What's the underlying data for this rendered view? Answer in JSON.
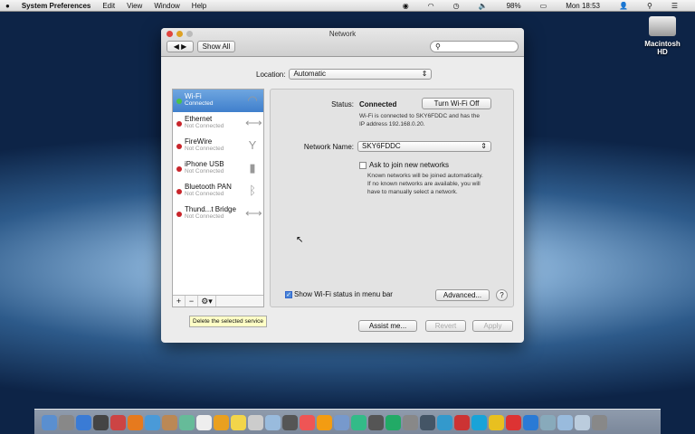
{
  "menubar": {
    "app": "System Preferences",
    "items": [
      "Edit",
      "View",
      "Window",
      "Help"
    ],
    "battery": "98%",
    "clock": "Mon 18:53"
  },
  "desktop": {
    "drive_label": "Macintosh HD"
  },
  "window": {
    "title": "Network",
    "show_all": "Show All",
    "search_placeholder": "",
    "location_label": "Location:",
    "location_value": "Automatic",
    "services": [
      {
        "name": "Wi-Fi",
        "status": "Connected",
        "icon": "wifi-icon",
        "selected": true
      },
      {
        "name": "Ethernet",
        "status": "Not Connected",
        "icon": "ethernet-icon"
      },
      {
        "name": "FireWire",
        "status": "Not Connected",
        "icon": "firewire-icon"
      },
      {
        "name": "iPhone USB",
        "status": "Not Connected",
        "icon": "iphone-icon"
      },
      {
        "name": "Bluetooth PAN",
        "status": "Not Connected",
        "icon": "bluetooth-icon"
      },
      {
        "name": "Thund...t Bridge",
        "status": "Not Connected",
        "icon": "thunderbolt-bridge-icon"
      }
    ],
    "sidebar_buttons": [
      "+",
      "−",
      "⚙▾"
    ],
    "status_label": "Status:",
    "status_value": "Connected",
    "turn_off": "Turn Wi-Fi Off",
    "status_desc1": "Wi-Fi is connected to SKY6FDDC and has the",
    "status_desc2": "IP address 192.168.0.20.",
    "network_name_label": "Network Name:",
    "network_name_value": "SKY6FDDC",
    "ask_join_label": "Ask to join new networks",
    "ask_join_checked": false,
    "ask_desc1": "Known networks will be joined automatically.",
    "ask_desc2": "If no known networks are available, you will",
    "ask_desc3": "have to manually select a network.",
    "show_status_label": "Show Wi-Fi status in menu bar",
    "show_status_checked": true,
    "advanced": "Advanced...",
    "help": "?",
    "assist": "Assist me...",
    "revert": "Revert",
    "apply": "Apply",
    "tooltip": "Delete the selected service"
  },
  "dock_colors": [
    "#5a8fd0",
    "#888",
    "#3a7bd5",
    "#444",
    "#c44",
    "#e67a1e",
    "#4a9ad8",
    "#b85",
    "#6b9",
    "#eee",
    "#e9a020",
    "#f2d54a",
    "#ccc",
    "#9bd",
    "#555",
    "#e55",
    "#f39c12",
    "#79c",
    "#3b8",
    "#555",
    "#2a6",
    "#888",
    "#456",
    "#39c",
    "#c33",
    "#19a3d8",
    "#e8c020",
    "#d33",
    "#2a7ad5",
    "#8ab",
    "#9bd",
    "#bcd",
    "#888"
  ]
}
